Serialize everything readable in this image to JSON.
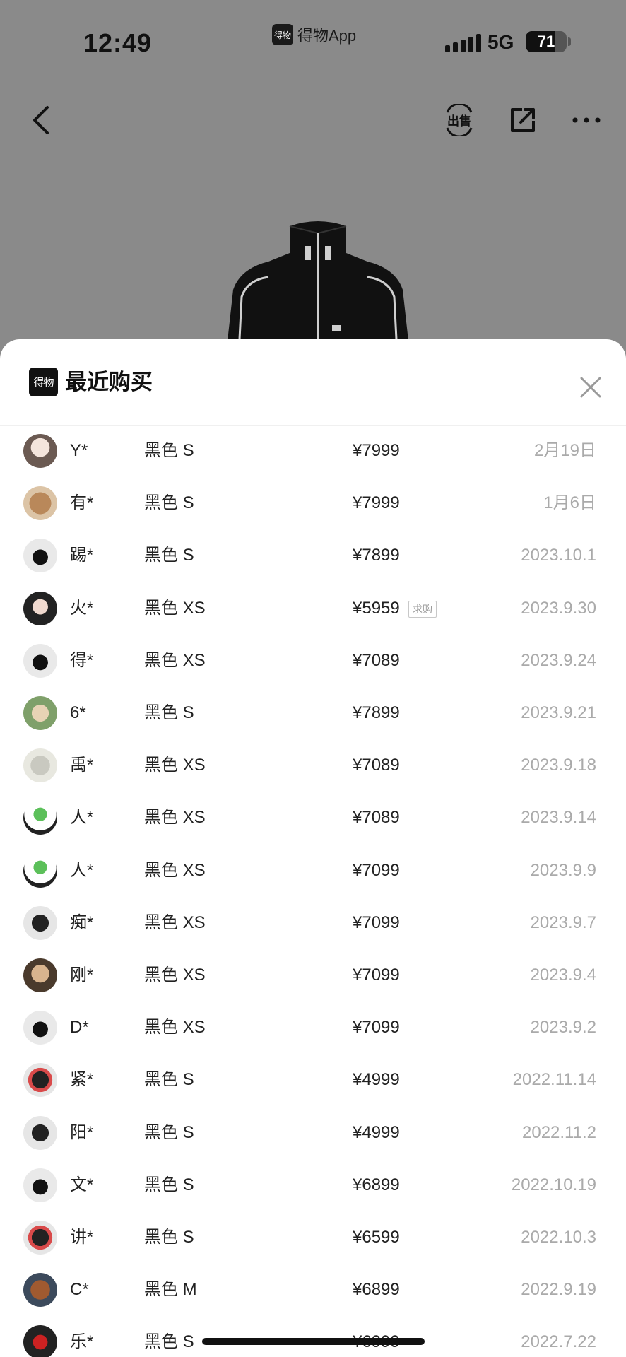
{
  "status_bar": {
    "time": "12:49",
    "app_name": "得物App",
    "app_logo_text": "得物",
    "network": "5G",
    "battery": "71",
    "battery_fraction": 0.71
  },
  "nav": {
    "sell_label": "出售",
    "icons": [
      "back-arrow-icon",
      "sell-icon",
      "share-icon",
      "more-icon"
    ]
  },
  "sheet": {
    "logo_text": "得物",
    "title": "最近购买",
    "close_icon": "close-icon"
  },
  "colors": {
    "overlay": "#8a8a8a",
    "text": "#222222",
    "date": "#aaaaaa",
    "tag_border": "#c8c8c8"
  },
  "purchases": [
    {
      "name": "Y*",
      "spec": "黑色 S",
      "price": "¥7999",
      "date": "2月19日"
    },
    {
      "name": "有*",
      "spec": "黑色 S",
      "price": "¥7999",
      "date": "1月6日"
    },
    {
      "name": "踢*",
      "spec": "黑色 S",
      "price": "¥7899",
      "date": "2023.10.1"
    },
    {
      "name": "火*",
      "spec": "黑色 XS",
      "price": "¥5959",
      "tag": "求购",
      "date": "2023.9.30"
    },
    {
      "name": "得*",
      "spec": "黑色 XS",
      "price": "¥7089",
      "date": "2023.9.24"
    },
    {
      "name": "6*",
      "spec": "黑色 S",
      "price": "¥7899",
      "date": "2023.9.21"
    },
    {
      "name": "禹*",
      "spec": "黑色 XS",
      "price": "¥7089",
      "date": "2023.9.18"
    },
    {
      "name": "人*",
      "spec": "黑色 XS",
      "price": "¥7089",
      "date": "2023.9.14"
    },
    {
      "name": "人*",
      "spec": "黑色 XS",
      "price": "¥7099",
      "date": "2023.9.9"
    },
    {
      "name": "痴*",
      "spec": "黑色 XS",
      "price": "¥7099",
      "date": "2023.9.7"
    },
    {
      "name": "刚*",
      "spec": "黑色 XS",
      "price": "¥7099",
      "date": "2023.9.4"
    },
    {
      "name": "D*",
      "spec": "黑色 XS",
      "price": "¥7099",
      "date": "2023.9.2"
    },
    {
      "name": "紧*",
      "spec": "黑色 S",
      "price": "¥4999",
      "date": "2022.11.14"
    },
    {
      "name": "阳*",
      "spec": "黑色 S",
      "price": "¥4999",
      "date": "2022.11.2"
    },
    {
      "name": "文*",
      "spec": "黑色 S",
      "price": "¥6899",
      "date": "2022.10.19"
    },
    {
      "name": "讲*",
      "spec": "黑色 S",
      "price": "¥6599",
      "date": "2022.10.3"
    },
    {
      "name": "C*",
      "spec": "黑色 M",
      "price": "¥6899",
      "date": "2022.9.19"
    },
    {
      "name": "乐*",
      "spec": "黑色 S",
      "price": "¥6999",
      "date": "2022.7.22"
    }
  ]
}
